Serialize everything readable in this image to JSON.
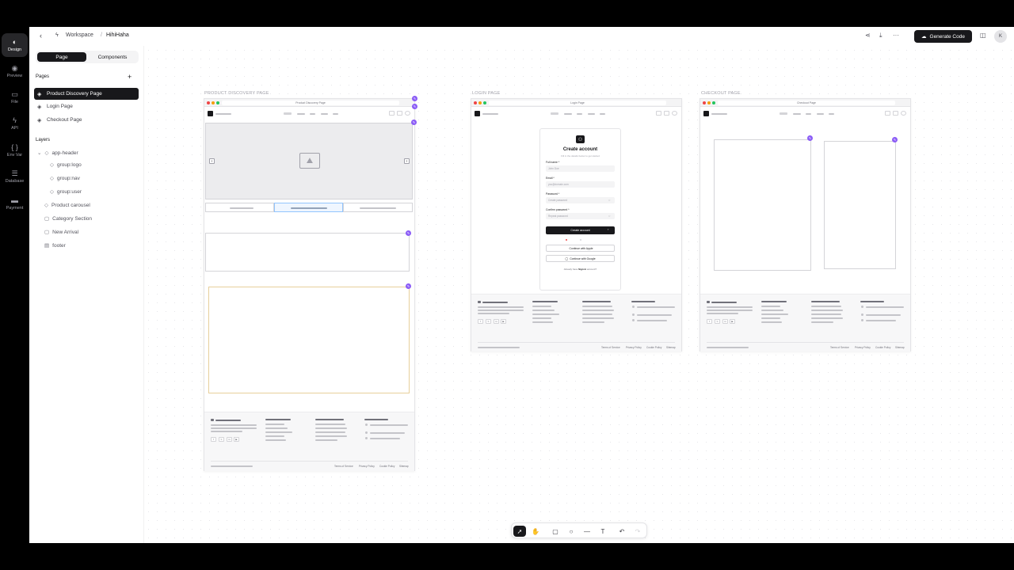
{
  "rail": {
    "items": [
      {
        "label": "Design",
        "icon": "◐"
      },
      {
        "label": "Preview",
        "icon": "◉"
      },
      {
        "label": "File",
        "icon": "▭"
      },
      {
        "label": "API",
        "icon": "ϟ"
      },
      {
        "label": "Env Var",
        "icon": "{ }"
      },
      {
        "label": "Database",
        "icon": "☰"
      },
      {
        "label": "Payment",
        "icon": "▬"
      }
    ]
  },
  "header": {
    "back_icon": "‹",
    "workspace": "Workspace",
    "separator": "/",
    "project": "HihiHaha",
    "share_icon": "⋖",
    "download_icon": "⤓",
    "more_icon": "···",
    "generate_label": "Generate Code",
    "panel_icon": "◫",
    "avatar": "K"
  },
  "sidebar": {
    "tabs": [
      "Page",
      "Components"
    ],
    "pages_title": "Pages",
    "add_icon": "+",
    "pages": [
      "Product Discovery Page",
      "Login Page",
      "Checkout Page"
    ],
    "layers_title": "Layers",
    "layers": [
      {
        "label": "app-header",
        "icon": "◇"
      },
      {
        "label": "group:logo",
        "icon": "◇"
      },
      {
        "label": "group:nav",
        "icon": "◇"
      },
      {
        "label": "group:user",
        "icon": "◇"
      },
      {
        "label": "Product carousel",
        "icon": "◇"
      },
      {
        "label": "Category Section",
        "icon": "▢"
      },
      {
        "label": "New Arrival",
        "icon": "▢"
      },
      {
        "label": "footer",
        "icon": "▤"
      }
    ]
  },
  "frames": {
    "discovery": {
      "label": "PRODUCT DISCOVERY PAGE",
      "url": "Product Discovery Page"
    },
    "login": {
      "label": "LOGIN PAGE",
      "url": "Login Page"
    },
    "checkout": {
      "label": "CHECKOUT PAGE",
      "url": "Checkout Page"
    }
  },
  "login_form": {
    "title": "Create account",
    "subtitle": "Fill in the details below to get started",
    "fields": [
      {
        "label": "Full name *",
        "placeholder": "John Doe"
      },
      {
        "label": "Email *",
        "placeholder": "you@domain.com"
      },
      {
        "label": "Password *",
        "placeholder": "Create password"
      },
      {
        "label": "Confirm password *",
        "placeholder": "Repeat password"
      }
    ],
    "submit": "Create account",
    "apple": "Continue with Apple",
    "google": "Continue with Google",
    "signin_prefix": "Already have",
    "signin_link": "Sign in",
    "signin_suffix": "account?"
  },
  "footer_links": [
    "Terms of Service",
    "Privacy Policy",
    "Cookie Policy",
    "Sitemap"
  ],
  "social": [
    "f",
    "𝕏",
    "in",
    "▶"
  ],
  "toolbar": {
    "tools": [
      {
        "name": "select-tool",
        "icon": "➚"
      },
      {
        "name": "hand-tool",
        "icon": "✋"
      },
      {
        "name": "rectangle-tool",
        "icon": "▢"
      },
      {
        "name": "ellipse-tool",
        "icon": "○"
      },
      {
        "name": "line-tool",
        "icon": "—"
      },
      {
        "name": "text-tool",
        "icon": "T"
      },
      {
        "name": "undo-tool",
        "icon": "↶"
      },
      {
        "name": "redo-tool",
        "icon": "↷"
      }
    ]
  },
  "colors": {
    "accent": "#8b5cf6",
    "primary": "#18181b",
    "selection": "#93c5fd"
  }
}
